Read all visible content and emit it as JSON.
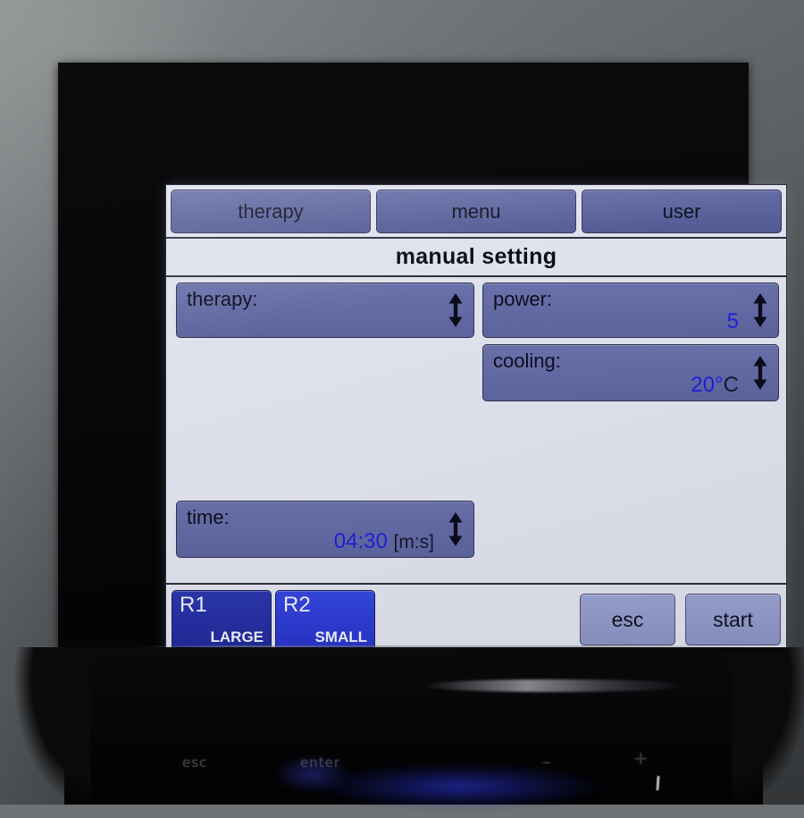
{
  "device": {
    "panel_legends": [
      {
        "name": "esc-key-legend",
        "text": "esc"
      },
      {
        "name": "enter-key-legend",
        "text": "enter"
      },
      {
        "name": "minus-key-legend",
        "text": "–"
      },
      {
        "name": "plus-key-legend",
        "text": "+"
      }
    ]
  },
  "screen": {
    "tabs": [
      {
        "id": "therapy",
        "label": "therapy"
      },
      {
        "id": "menu",
        "label": "menu"
      },
      {
        "id": "user",
        "label": "user"
      }
    ],
    "title": "manual setting",
    "fields": [
      {
        "id": "therapy",
        "label": "therapy:",
        "value": "",
        "suffix": "",
        "spinner": "up-down-arrow-icon"
      },
      {
        "id": "power",
        "label": "power:",
        "value": "5",
        "suffix": "",
        "spinner": "up-down-arrow-icon"
      },
      {
        "id": "cooling",
        "label": "cooling:",
        "value": "20°",
        "unit": "C",
        "suffix": "",
        "spinner": "up-down-arrow-icon"
      },
      {
        "id": "time",
        "label": "time:",
        "value": "04:30",
        "suffix": "[m:s]",
        "spinner": "up-down-arrow-icon"
      }
    ],
    "applicators": [
      {
        "id": "R1",
        "name": "R1",
        "size": "LARGE",
        "color": "#242ea0",
        "selected": true
      },
      {
        "id": "R2",
        "name": "R2",
        "size": "SMALL",
        "color": "#2c3bd2",
        "selected": false
      }
    ],
    "actions": [
      {
        "id": "esc",
        "label": "esc"
      },
      {
        "id": "start",
        "label": "start"
      }
    ]
  },
  "colors": {
    "lcd_background": "#dfe2ed",
    "button_blue": "#5a629c",
    "field_blue": "#636aa4",
    "value_blue": "#1d1fd8",
    "action_button": "#929ac9",
    "r1_blue": "#242ea0",
    "r2_blue": "#2c3bd2",
    "bezel_black": "#070709"
  }
}
